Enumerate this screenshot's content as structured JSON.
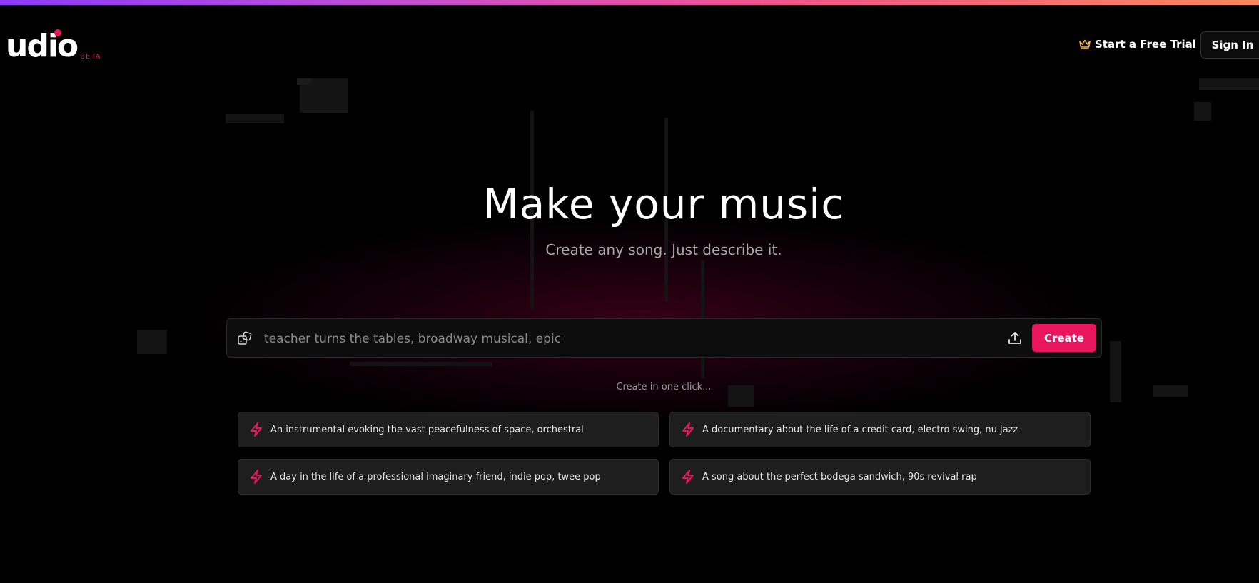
{
  "header": {
    "logo_text": "udio",
    "logo_badge": "BETA",
    "trial_label": "Start a Free Trial",
    "signin_label": "Sign In"
  },
  "hero": {
    "title": "Make your music",
    "subtitle": "Create any song. Just describe it."
  },
  "prompt": {
    "placeholder": "teacher turns the tables, broadway musical, epic",
    "value": "",
    "create_label": "Create"
  },
  "one_click_label": "Create in one click...",
  "suggestions": [
    {
      "label": "An instrumental evoking the vast peacefulness of space, orchestral"
    },
    {
      "label": "A documentary about the life of a credit card, electro swing, nu jazz"
    },
    {
      "label": "A day in the life of a professional imaginary friend, indie pop, twee pop"
    },
    {
      "label": "A song about the perfect bodega sandwich, 90s revival rap"
    }
  ],
  "colors": {
    "accent": "#e8175d",
    "crown": "#f5b942",
    "background": "#000000"
  },
  "icons": {
    "trial": "crown-icon",
    "prompt_left": "dice-icon",
    "prompt_right": "upload-icon",
    "suggestion": "bolt-icon"
  }
}
